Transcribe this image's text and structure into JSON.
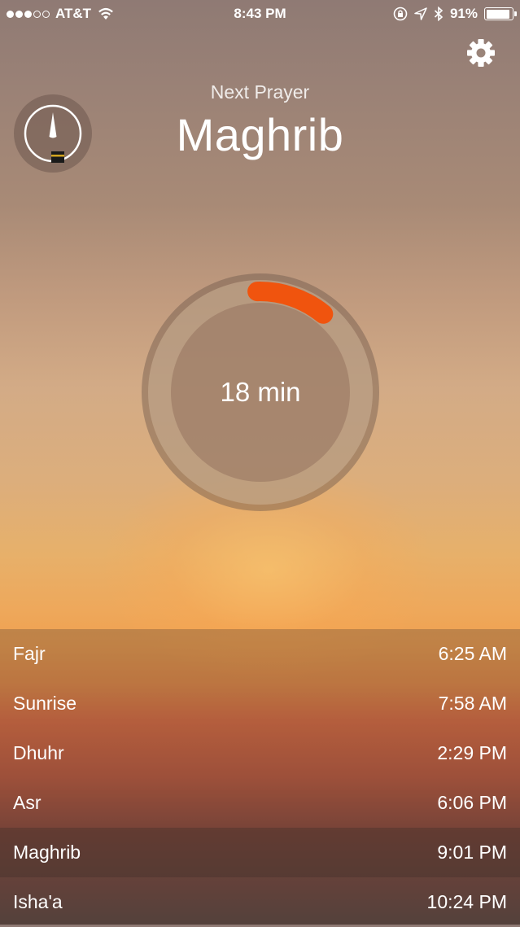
{
  "status_bar": {
    "carrier": "AT&T",
    "time": "8:43 PM",
    "battery": "91%",
    "battery_level": 0.91
  },
  "header": {
    "next_label": "Next Prayer",
    "next_prayer": "Maghrib"
  },
  "countdown": {
    "text": "18 min"
  },
  "prayers": [
    {
      "name": "Fajr",
      "time": "6:25 AM"
    },
    {
      "name": "Sunrise",
      "time": "7:58 AM"
    },
    {
      "name": "Dhuhr",
      "time": "2:29 PM"
    },
    {
      "name": "Asr",
      "time": "6:06 PM"
    },
    {
      "name": "Maghrib",
      "time": "9:01 PM",
      "current": true
    },
    {
      "name": "Isha'a",
      "time": "10:24 PM"
    }
  ],
  "colors": {
    "accent": "#f0540e"
  },
  "icons": {
    "settings": "gear-icon",
    "qibla": "qibla-compass-icon",
    "wifi": "wifi-icon",
    "lock": "orientation-lock-icon",
    "location": "location-arrow-icon",
    "bluetooth": "bluetooth-icon",
    "battery": "battery-icon"
  }
}
